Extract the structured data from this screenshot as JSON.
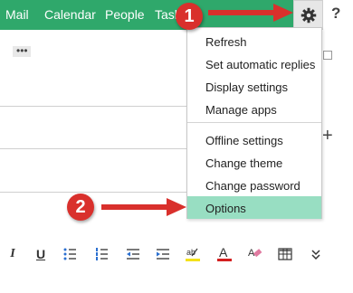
{
  "nav": {
    "items": [
      "Mail",
      "Calendar",
      "People",
      "Tasks"
    ]
  },
  "header": {
    "settings_icon": "gear-icon",
    "help_label": "?"
  },
  "left_pane": {
    "more_label": "•••"
  },
  "settings_menu": {
    "items": [
      {
        "label": "Refresh"
      },
      {
        "label": "Set automatic replies"
      },
      {
        "label": "Display settings"
      },
      {
        "label": "Manage apps"
      },
      {
        "label": "Offline settings"
      },
      {
        "label": "Change theme"
      },
      {
        "label": "Change password"
      },
      {
        "label": "Options",
        "selected": true
      }
    ]
  },
  "toolbar": {
    "italic_label": "I",
    "underline_label": "U"
  },
  "annotations": {
    "callout1": "1",
    "callout2": "2"
  },
  "colors": {
    "nav_bar": "#2fa86b",
    "selected_item": "#98dec2",
    "callout": "#d9302c"
  }
}
